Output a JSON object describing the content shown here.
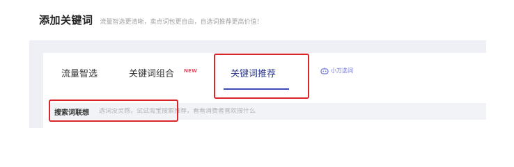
{
  "header": {
    "title": "添加关键词",
    "subtitle": "流量智选更清晰，卖点词包更自由，自选词推荐更高价值！"
  },
  "tabs": [
    {
      "label": "流量智选",
      "active": false
    },
    {
      "label": "关键词组合",
      "badge": "NEW",
      "active": false
    },
    {
      "label": "关键词推荐",
      "active": true
    }
  ],
  "assistant": {
    "label": "小万选词",
    "icon": "bot-icon"
  },
  "search": {
    "label": "搜索词联想",
    "placeholder": "选词没灵感，试试淘宝搜索推荐，看看消费者喜欢搜什么"
  },
  "colors": {
    "highlight": "#d8262a",
    "active_tab": "#2f3a8f",
    "badge": "#e84a5f"
  }
}
